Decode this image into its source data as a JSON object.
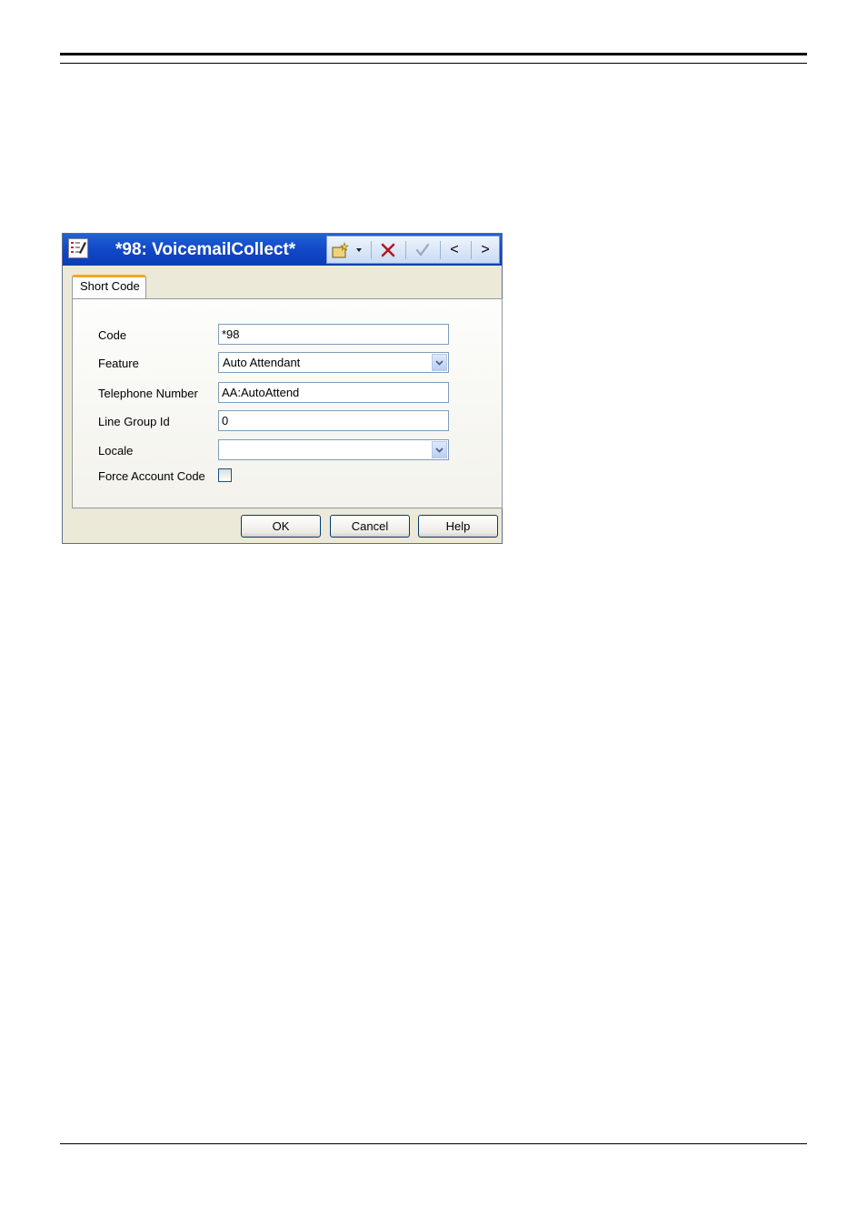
{
  "dialog": {
    "title": "*98: VoicemailCollect*",
    "toolbar": {
      "new_icon": "new-item-icon",
      "dropdown_icon": "dropdown-arrow-icon",
      "delete_icon": "delete-x-icon",
      "apply_icon": "checkmark-icon",
      "prev_label": "<",
      "next_label": ">"
    },
    "tab_label": "Short Code",
    "fields": {
      "code": {
        "label": "Code",
        "value": "*98"
      },
      "feature": {
        "label": "Feature",
        "value": "Auto Attendant"
      },
      "telephone_number": {
        "label": "Telephone Number",
        "value": "AA:AutoAttend"
      },
      "line_group_id": {
        "label": "Line Group Id",
        "value": "0"
      },
      "locale": {
        "label": "Locale",
        "value": ""
      },
      "force_account_code": {
        "label": "Force Account Code",
        "checked": false
      }
    },
    "buttons": {
      "ok": "OK",
      "cancel": "Cancel",
      "help": "Help"
    }
  },
  "colors": {
    "titlebar": "#1247c6",
    "tab_accent": "#f5a623",
    "delete_icon": "#b0161a"
  }
}
